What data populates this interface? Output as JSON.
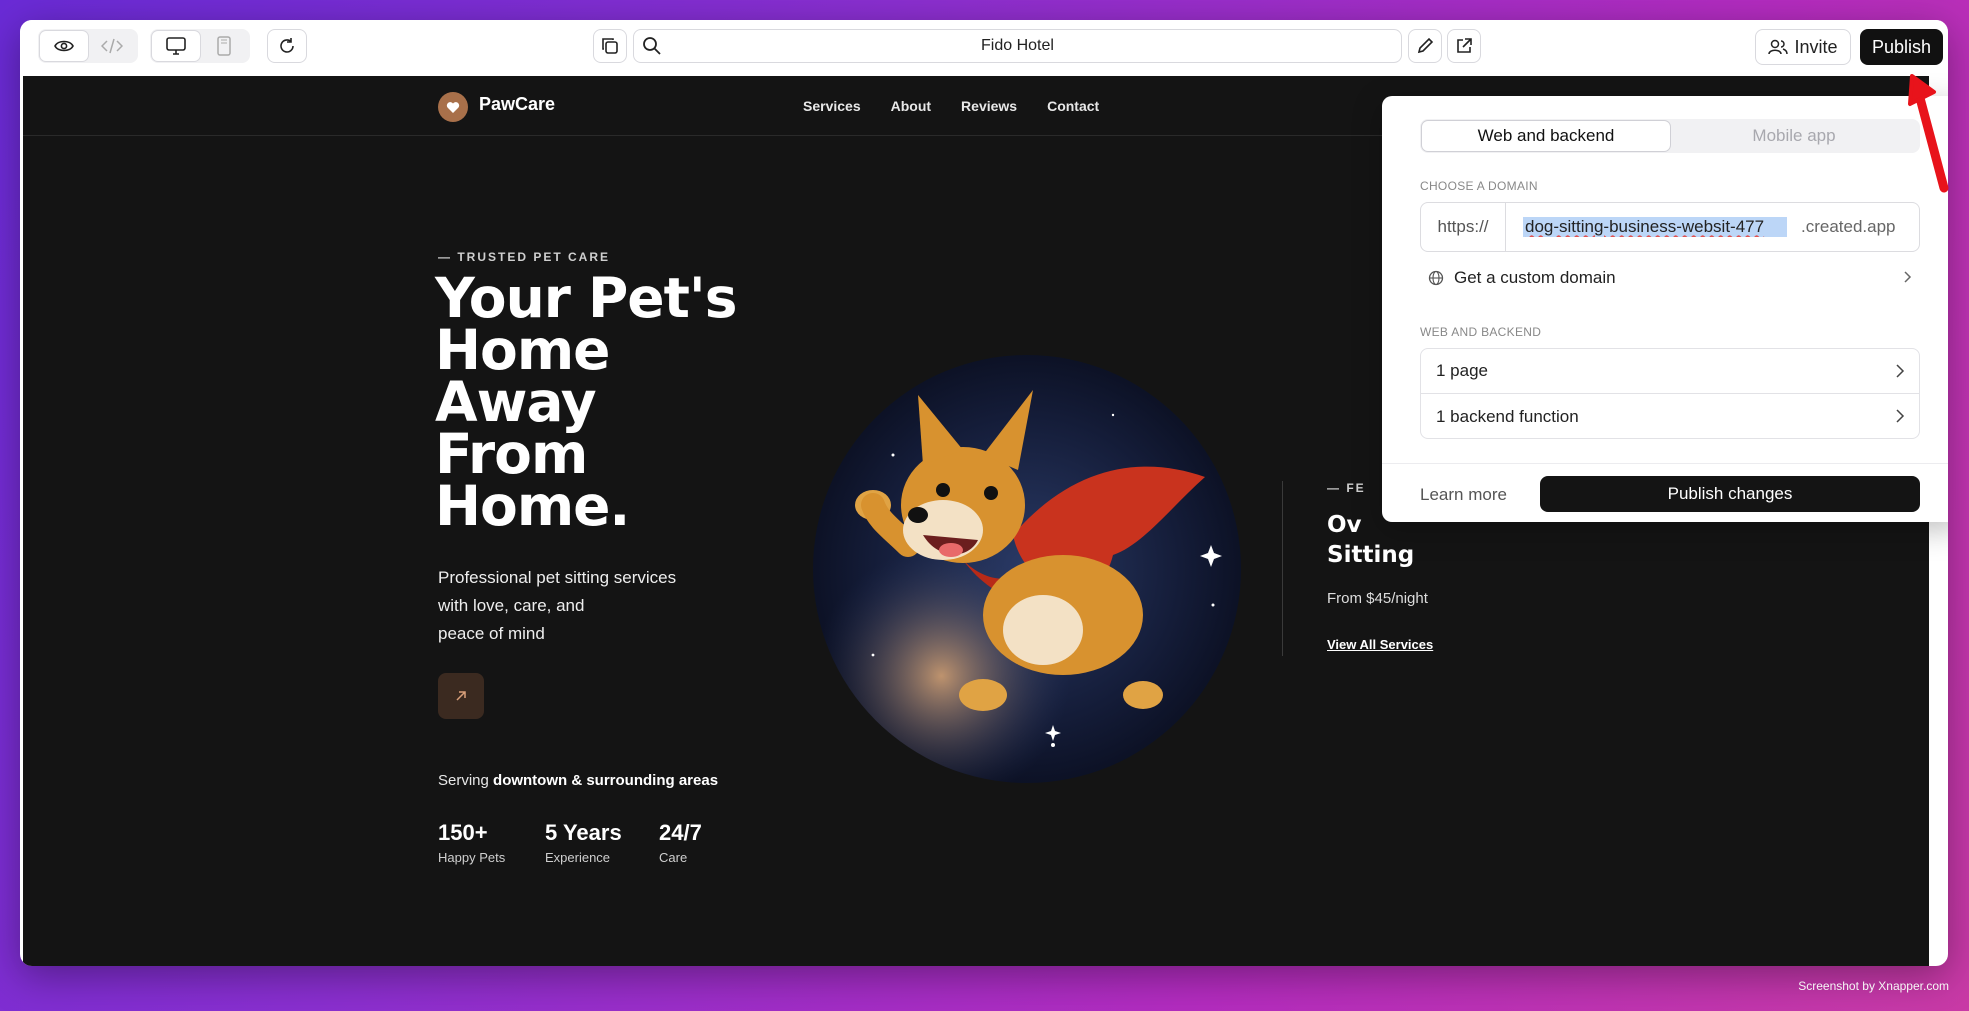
{
  "toolbar": {
    "address": "Fido Hotel",
    "invite_label": "Invite",
    "publish_label": "Publish"
  },
  "site": {
    "brand": "PawCare",
    "nav": [
      "Services",
      "About",
      "Reviews",
      "Contact"
    ],
    "eyebrow": "— TRUSTED PET CARE",
    "title_lines": [
      "Your Pet's",
      "Home",
      "Away",
      "From",
      "Home."
    ],
    "subtitle_lines": [
      "Professional pet sitting services",
      "with love, care, and",
      "peace of mind"
    ],
    "serving_prefix": "Serving",
    "serving_bold": "downtown & surrounding areas",
    "stats": [
      {
        "num": "150+",
        "label": "Happy Pets"
      },
      {
        "num": "5 Years",
        "label": "Experience"
      },
      {
        "num": "24/7",
        "label": "Care"
      }
    ],
    "featured": {
      "eyebrow": "— FE",
      "title_lines": [
        "Ov",
        "Sitting"
      ],
      "price": "From $45/night",
      "link": "View All Services"
    }
  },
  "popover": {
    "tabs": [
      "Web and backend",
      "Mobile app"
    ],
    "domain_label": "CHOOSE A DOMAIN",
    "protocol": "https://",
    "domain_value": "dog-sitting-business-websit-477",
    "domain_suffix": ".created.app",
    "custom_domain": "Get a custom domain",
    "backend_label": "WEB AND BACKEND",
    "rows": [
      "1 page",
      "1 backend function"
    ],
    "learn_more": "Learn more",
    "publish_changes": "Publish changes"
  },
  "watermark": "Screenshot by Xnapper.com",
  "colors": {
    "accent": "#111111",
    "logo": "#a8704a",
    "site_bg": "#141414",
    "annotation": "#e8131b"
  }
}
